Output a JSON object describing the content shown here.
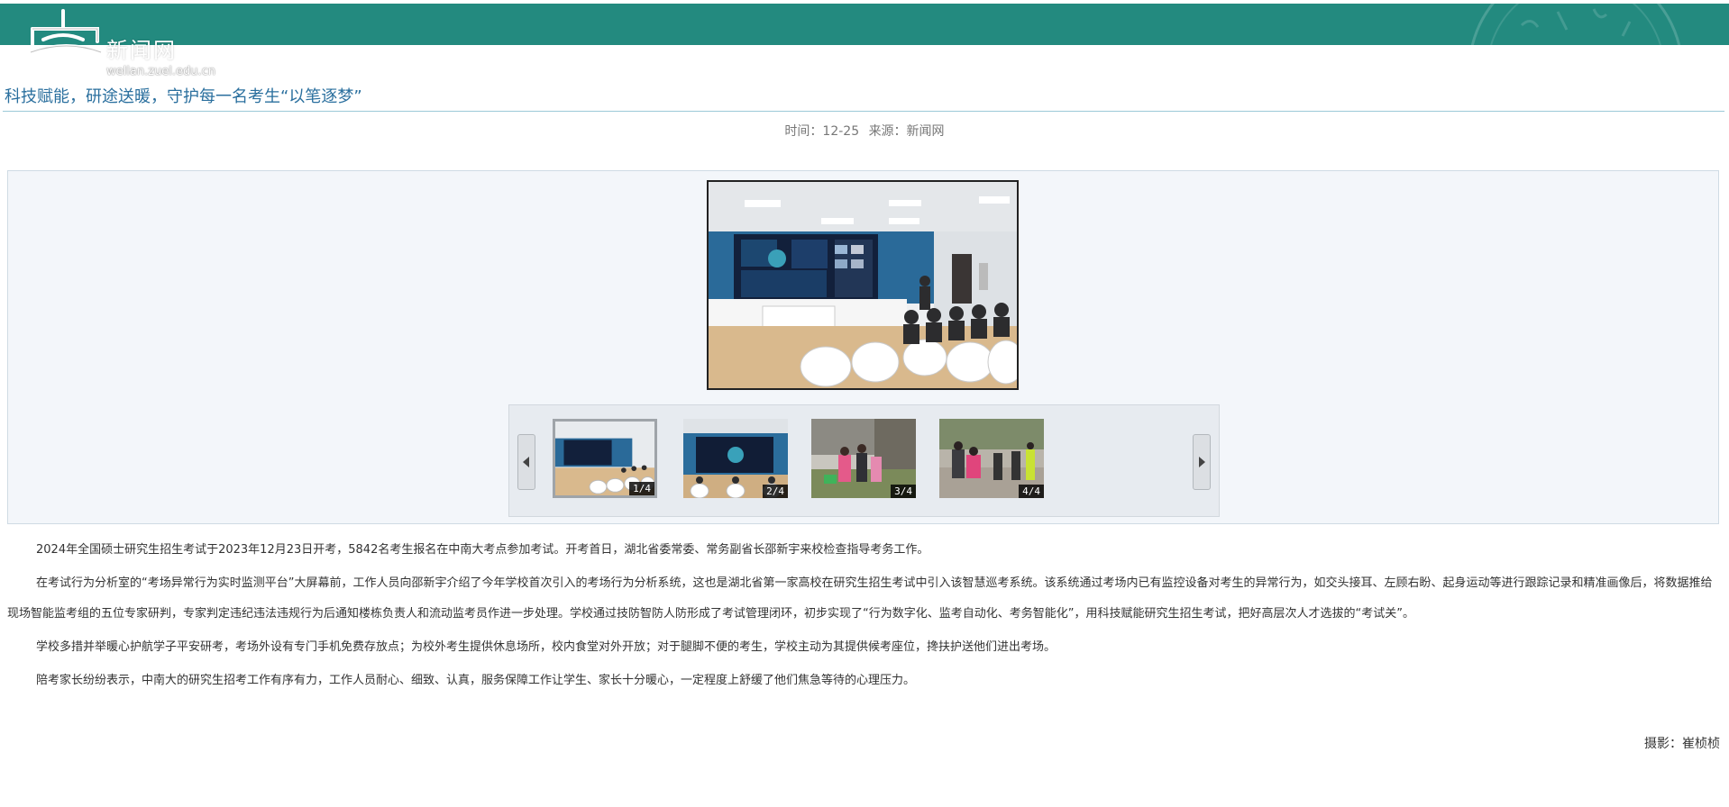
{
  "header": {
    "logo_text": "新闻网",
    "logo_domain": "wellan.zuel.edu.cn",
    "brand_color": "#238a7f"
  },
  "article": {
    "title": "科技赋能，研途送暖，守护每一名考生“以笔逐梦”",
    "meta_time": "时间：12-25",
    "meta_source": "来源：新闻网",
    "paragraphs": [
      "2024年全国硕士研究生招生考试于2023年12月23日开考，5842名考生报名在中南大考点参加考试。开考首日，湖北省委常委、常务副省长邵新宇来校检查指导考务工作。",
      "在考试行为分析室的“考场异常行为实时监测平台”大屏幕前，工作人员向邵新宇介绍了今年学校首次引入的考场行为分析系统，这也是湖北省第一家高校在研究生招生考试中引入该智慧巡考系统。该系统通过考场内已有监控设备对考生的异常行为，如交头接耳、左顾右盼、起身运动等进行跟踪记录和精准画像后，将数据推给现场智能监考组的五位专家研判，专家判定违纪违法违规行为后通知楼栋负责人和流动监考员作进一步处理。学校通过技防智防人防形成了考试管理闭环，初步实现了“行为数字化、监考自动化、考务智能化”，用科技赋能研究生招生考试，把好高层次人才选拔的“考试关”。",
      "学校多措并举暖心护航学子平安研考，考场外设有专门手机免费存放点；为校外考生提供休息场所，校内食堂对外开放；对于腿脚不便的考生，学校主动为其提供候考座位，搀扶护送他们进出考场。",
      "陪考家长纷纷表示，中南大的研究生招考工作有序有力，工作人员耐心、细致、认真，服务保障工作让学生、家长十分暖心，一定程度上舒缓了他们焦急等待的心理压力。"
    ],
    "photo_credit": "摄影：崔桢桢"
  },
  "gallery": {
    "main_image_icon": "monitoring-room-photo",
    "prev_icon": "triangle-left-icon",
    "next_icon": "triangle-right-icon",
    "thumbnails": [
      {
        "counter": "1/4",
        "icon": "monitoring-room-photo",
        "active": true
      },
      {
        "counter": "2/4",
        "icon": "screen-wall-photo",
        "active": false
      },
      {
        "counter": "3/4",
        "icon": "outdoor-people-photo",
        "active": false
      },
      {
        "counter": "4/4",
        "icon": "outdoor-escort-photo",
        "active": false
      }
    ]
  }
}
